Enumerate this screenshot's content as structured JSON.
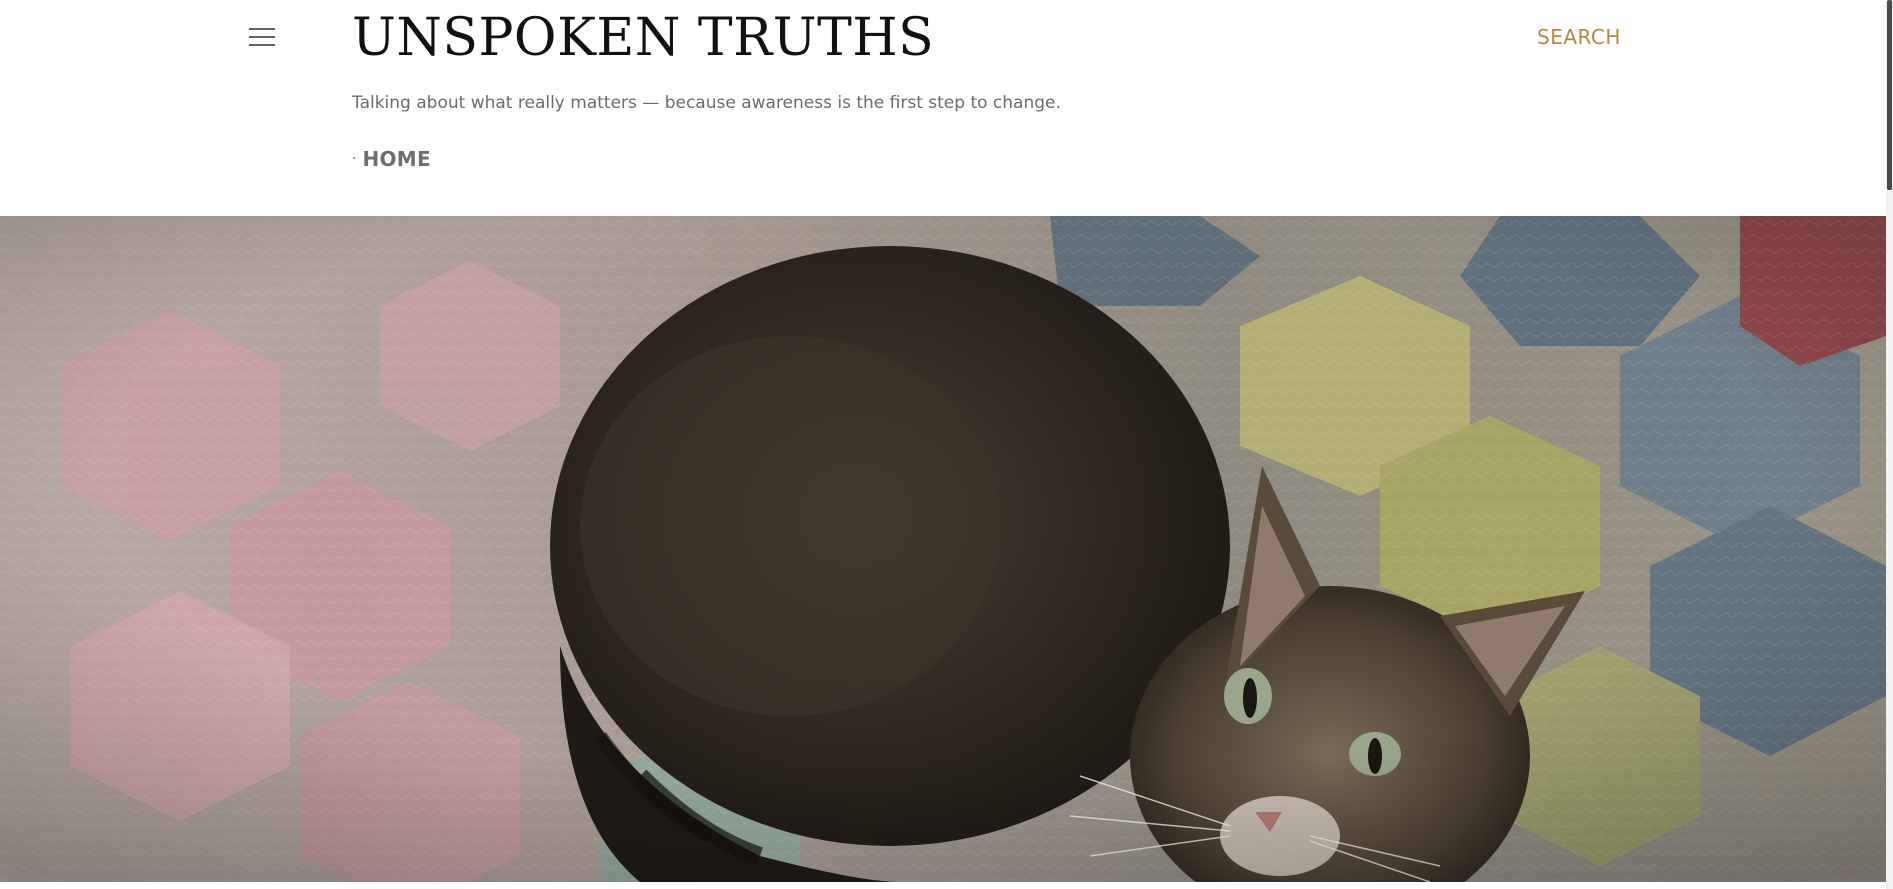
{
  "header": {
    "menu_icon": "hamburger-menu-icon",
    "title": "UNSPOKEN TRUTHS",
    "search_label": "SEARCH",
    "tagline": "Talking about what really matters — because awareness is the first step to change."
  },
  "nav": {
    "bullet": "·",
    "items": [
      {
        "label": "HOME"
      }
    ]
  },
  "colors": {
    "accent": "#b08a3c",
    "title": "#111111",
    "text_muted": "#6b6b6b"
  }
}
